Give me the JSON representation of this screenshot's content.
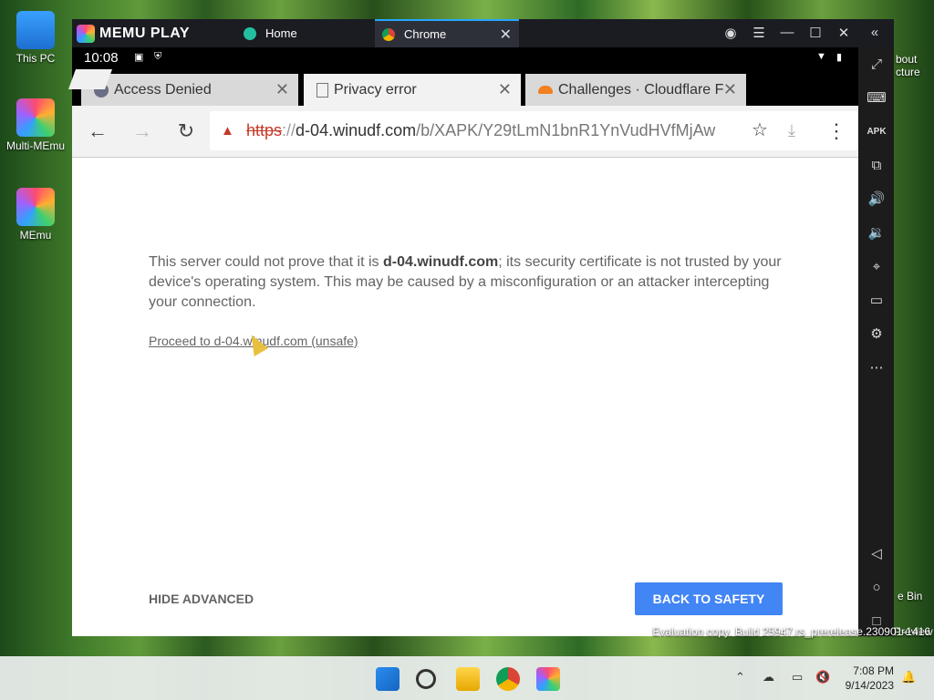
{
  "desktop": {
    "icons": [
      {
        "label": "This PC"
      },
      {
        "label": "Multi-MEmu"
      },
      {
        "label": "MEmu"
      }
    ],
    "right_icon_fragments": [
      "bout",
      "cture",
      "e Bin",
      "Preview"
    ],
    "watermark": {
      "line1": "Evaluation copy. Build 25947.rs_prerelease.230901-1416"
    }
  },
  "memu": {
    "brand": "MEMU PLAY",
    "tabs": [
      {
        "label": "Home"
      },
      {
        "label": "Chrome"
      }
    ]
  },
  "android": {
    "time": "10:08"
  },
  "chrome": {
    "tabs": [
      {
        "label": "Access Denied"
      },
      {
        "label": "Privacy error"
      },
      {
        "label": "Challenges · Cloudflare F"
      }
    ],
    "url": {
      "scheme": "https",
      "sep": "://",
      "host": "d-04.winudf.com",
      "path": "/b/XAPK/Y29tLmN1bnR1YnVudHVfMjAw"
    }
  },
  "page": {
    "msg_prefix": "This server could not prove that it is ",
    "msg_host": "d-04.winudf.com",
    "msg_suffix": "; its security certificate is not trusted by your device's operating system. This may be caused by a misconfiguration or an attacker intercepting your connection.",
    "proceed_link": "Proceed to d-04.winudf.com (unsafe)",
    "hide_advanced": "HIDE ADVANCED",
    "back_to_safety": "BACK TO SAFETY"
  },
  "taskbar": {
    "time": "7:08 PM",
    "date": "9/14/2023"
  },
  "colors": {
    "accent_blue": "#4285f4",
    "danger_red": "#c53929"
  }
}
